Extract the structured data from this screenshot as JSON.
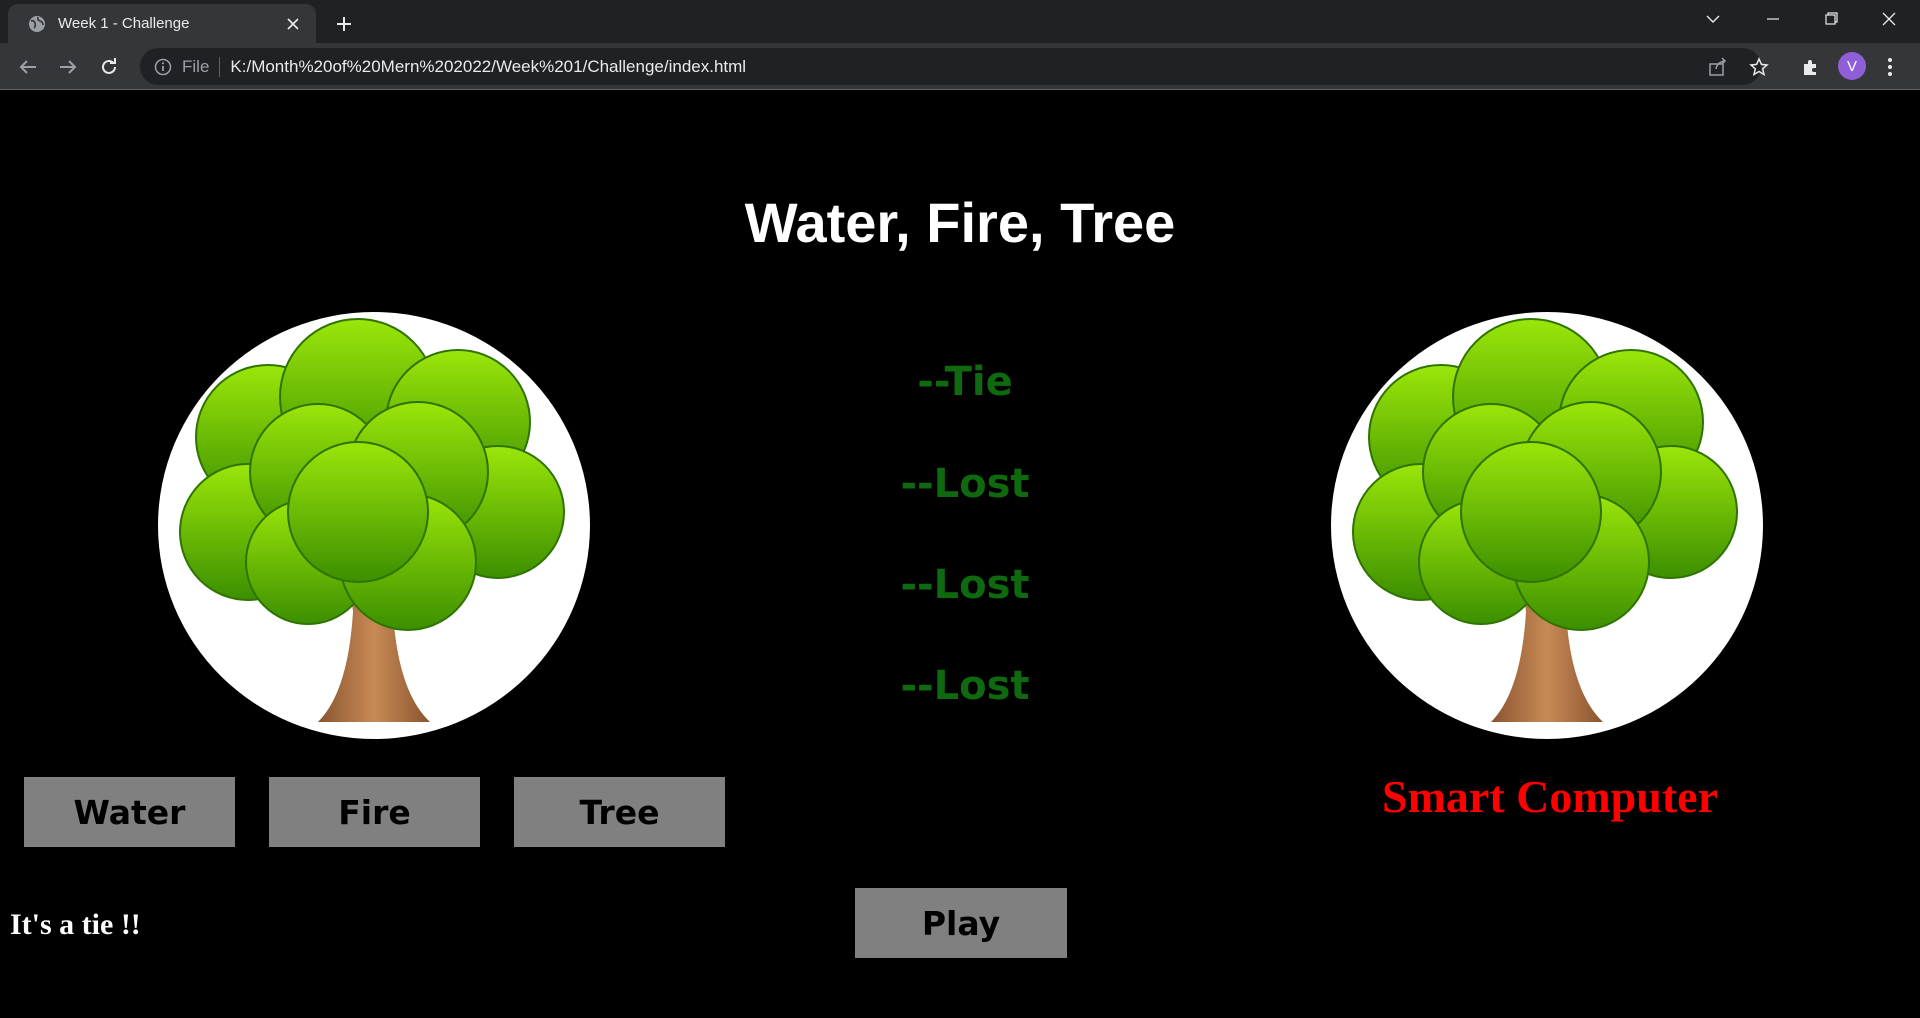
{
  "browser": {
    "tab_title": "Week 1 - Challenge",
    "url_scheme": "File",
    "url": "K:/Month%20of%20Mern%202022/Week%201/Challenge/index.html",
    "profile_initial": "V",
    "accent_color": "#8e5fd6"
  },
  "game": {
    "title": "Water, Fire, Tree",
    "player_choice_image": "tree",
    "computer_choice_image": "tree",
    "results": [
      "--Tie",
      "--Lost",
      "--Lost",
      "--Lost"
    ],
    "buttons": {
      "water": "Water",
      "fire": "Fire",
      "tree": "Tree",
      "play": "Play"
    },
    "computer_label": "Smart Computer",
    "outcome": "It's a tie !!",
    "colors": {
      "result_text": "#0f6a0f",
      "computer_label": "#ff0000",
      "button_bg": "#808080"
    }
  }
}
